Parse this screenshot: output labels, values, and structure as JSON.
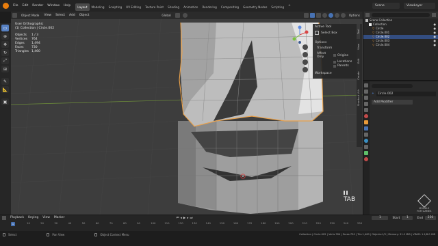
{
  "menu": {
    "items": [
      "File",
      "Edit",
      "Render",
      "Window",
      "Help"
    ],
    "workspaces": [
      "Layout",
      "Modeling",
      "Sculpting",
      "UV Editing",
      "Texture Paint",
      "Shading",
      "Animation",
      "Rendering",
      "Compositing",
      "Geometry Nodes",
      "Scripting"
    ],
    "active_workspace": "Layout",
    "scene_label": "Scene",
    "view_layer_label": "ViewLayer"
  },
  "viewport_header": {
    "mode": "Object Mode",
    "menus": [
      "View",
      "Select",
      "Add",
      "Object"
    ],
    "transform": "Global",
    "options": "Options"
  },
  "overlay": {
    "view_name": "User Orthographic",
    "collection": "(1) Collection | Circle.002",
    "stats": [
      {
        "label": "Objects",
        "value": "1 / 3"
      },
      {
        "label": "Vertices",
        "value": "764"
      },
      {
        "label": "Edges",
        "value": "1,494"
      },
      {
        "label": "Faces",
        "value": "730"
      },
      {
        "label": "Triangles",
        "value": "1,460"
      }
    ],
    "key_hint": "TAB"
  },
  "tool_panel": {
    "active_tool": "Active Tool",
    "select_box": "Select Box",
    "options": "Options",
    "transform": "Transform",
    "affect_only": "Affect Only",
    "checks": [
      "Origins",
      "Locations",
      "Parents"
    ],
    "workspace": "Workspace",
    "side_tabs": [
      "Tool",
      "View",
      "Edit",
      "Create",
      "Shortcut VUr"
    ]
  },
  "outliner": {
    "title": "Scene Collection",
    "items": [
      {
        "label": "Collection",
        "selected": false,
        "indent": 1
      },
      {
        "label": "Circle",
        "selected": false,
        "indent": 2
      },
      {
        "label": "Circle.001",
        "selected": false,
        "indent": 2
      },
      {
        "label": "Circle.002",
        "selected": true,
        "indent": 2
      },
      {
        "label": "Circle.003",
        "selected": false,
        "indent": 2
      },
      {
        "label": "Circle.004",
        "selected": false,
        "indent": 2
      }
    ]
  },
  "properties": {
    "object_name": "Circle.002",
    "add_modifier": "Add Modifier"
  },
  "timeline": {
    "menus": [
      "Playback",
      "Keying",
      "View",
      "Marker"
    ],
    "current_frame": "1",
    "start_label": "Start",
    "start": "1",
    "end_label": "End",
    "end": "250",
    "ticks": [
      "1",
      "10",
      "20",
      "30",
      "40",
      "50",
      "60",
      "70",
      "80",
      "90",
      "100",
      "110",
      "120",
      "130",
      "140",
      "150",
      "160",
      "170",
      "180",
      "190",
      "200",
      "210",
      "220",
      "230",
      "240",
      "250"
    ]
  },
  "status": {
    "select": "Select",
    "pan_view": "Pan View",
    "context_menu": "Object Context Menu",
    "info": "Collection | Circle.002 | Verts:764 | Faces:730 | Tris:1,460 | Objects:1/3 | Memory: 31.2 MiB | VRAM: 1.1/8.0 GiB"
  },
  "watermark": {
    "line1": "MODELS",
    "line2": "FOR GAMES"
  },
  "colors": {
    "accent": "#4772b3",
    "selection_outline": "#e8a04a",
    "viewport_bg": "#3d3d3d"
  }
}
